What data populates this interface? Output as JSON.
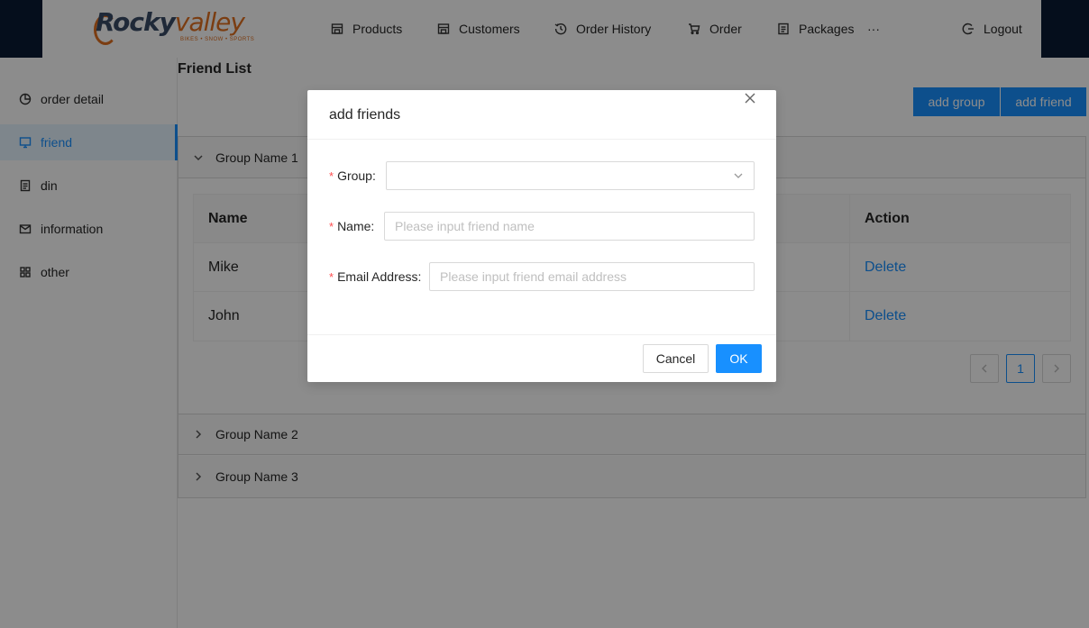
{
  "header": {
    "logo_text_rocky": "Rocky",
    "logo_text_valley": "valley",
    "logo_tagline": "BIKES • SNOW • SPORTS",
    "nav": [
      {
        "label": "Products",
        "icon": "shop-icon"
      },
      {
        "label": "Customers",
        "icon": "shop-icon"
      },
      {
        "label": "Order History",
        "icon": "history-icon"
      },
      {
        "label": "Order",
        "icon": "cart-icon"
      },
      {
        "label": "Packages",
        "icon": "file-icon"
      }
    ],
    "more": "···",
    "logout": "Logout"
  },
  "sidebar": {
    "items": [
      {
        "label": "order detail",
        "icon": "pie-chart-icon"
      },
      {
        "label": "friend",
        "icon": "desktop-icon"
      },
      {
        "label": "din",
        "icon": "file-text-icon"
      },
      {
        "label": "information",
        "icon": "mail-icon"
      },
      {
        "label": "other",
        "icon": "appstore-icon"
      }
    ],
    "active_index": 1
  },
  "main": {
    "title": "Friend List",
    "add_group_label": "add group",
    "add_friend_label": "add friend",
    "groups": [
      {
        "name": "Group Name 1",
        "expanded": true
      },
      {
        "name": "Group Name 2",
        "expanded": false
      },
      {
        "name": "Group Name 3",
        "expanded": false
      }
    ],
    "table": {
      "columns": [
        "Name",
        "Action"
      ],
      "rows": [
        {
          "name": "Mike",
          "action": "Delete"
        },
        {
          "name": "John",
          "action": "Delete"
        }
      ]
    },
    "pagination": {
      "current": "1"
    }
  },
  "modal": {
    "title": "add friends",
    "close_glyph": "X",
    "fields": {
      "group": {
        "label": "Group",
        "value": ""
      },
      "name": {
        "label": "Name",
        "placeholder": "Please input friend name"
      },
      "email": {
        "label": "Email Address",
        "placeholder": "Please input friend email address"
      }
    },
    "required_mark": "*",
    "label_colon": ":",
    "cancel_label": "Cancel",
    "ok_label": "OK"
  },
  "colors": {
    "primary": "#1890ff",
    "header_dark": "#0a1a33",
    "logo_orange": "#e07020",
    "required": "#ff4d4f"
  }
}
